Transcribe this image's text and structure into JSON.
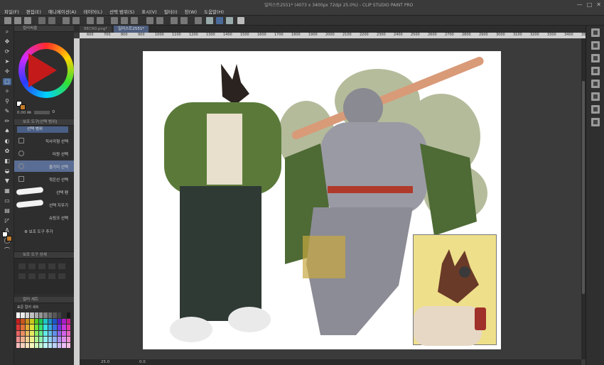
{
  "app": {
    "title": "일러스트2551* (4073 x 3400px 72dpi 25.0%) - CLIP STUDIO PAINT PRO"
  },
  "menu": [
    "파일(F)",
    "편집(E)",
    "애니메이션(A)",
    "레이어(L)",
    "선택 범위(S)",
    "표시(V)",
    "필터(I)",
    "창(W)",
    "도움말(H)"
  ],
  "window_controls": [
    "—",
    "□",
    "✕"
  ],
  "left_panels": {
    "color_wheel_title": "컬러써클",
    "brush_size": "0.00 ㎜",
    "brush_value": "0",
    "subtool_panel_title": "보조 도구[선택 범위]",
    "subtool_tab": "선택 범위",
    "subtools": [
      {
        "label": "직사각형 선택",
        "selected": false
      },
      {
        "label": "타원 선택",
        "selected": false
      },
      {
        "label": "올가미 선택",
        "selected": true
      },
      {
        "label": "꺾은선 선택",
        "selected": false
      },
      {
        "label": "선택 펜",
        "selected": false
      },
      {
        "label": "선택 지우기",
        "selected": false
      },
      {
        "label": "슈링크 선택",
        "selected": false
      }
    ],
    "add_subtool": "보조 도구 추가",
    "mid_panel_title": "보조 도구 상세",
    "palette_title": "컬러 세트",
    "palette_subtitle": "표준 컬러 세트"
  },
  "canvas": {
    "tabs": [
      {
        "label": "8ECR0.png*",
        "active": false
      },
      {
        "label": "일러스트2551*",
        "active": true
      }
    ],
    "ruler_labels": [
      "600",
      "700",
      "800",
      "900",
      "1000",
      "1100",
      "1200",
      "1300",
      "1400",
      "1500",
      "1600",
      "1700",
      "1800",
      "1900",
      "2000",
      "2100",
      "2200",
      "2300",
      "2400",
      "2500",
      "2600",
      "2700",
      "2800",
      "2900",
      "3000",
      "3100",
      "3200",
      "3300",
      "3400",
      "3500"
    ],
    "zoom": "25.0",
    "status_angle": "0.0"
  },
  "colors": {
    "accent": "#4a6a9a",
    "selection_highlight": "#5a6d94",
    "main_color": "#ffffff",
    "sub_color": "#c07a2a"
  }
}
